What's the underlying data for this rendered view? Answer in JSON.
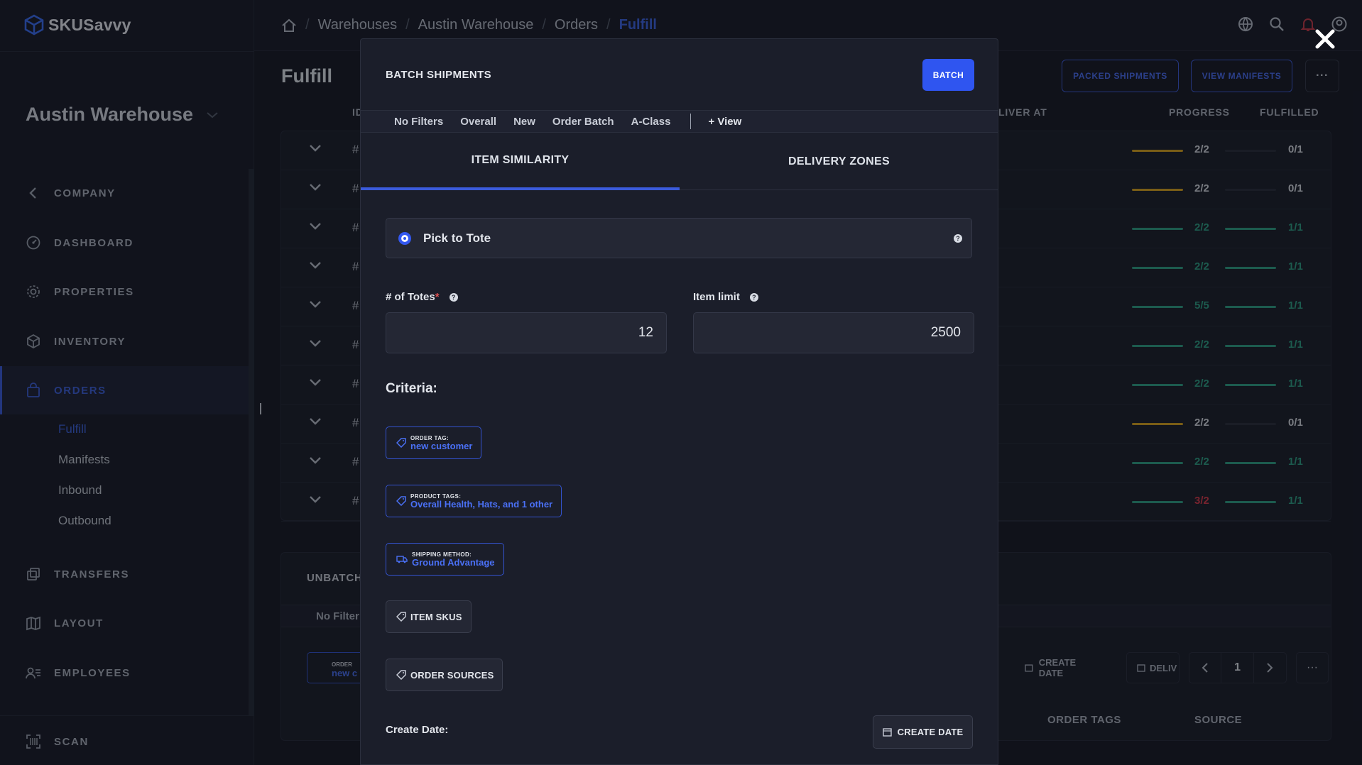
{
  "app": {
    "name": "SKUSavvy"
  },
  "sidebar": {
    "warehouse": "Austin Warehouse",
    "items": [
      {
        "label": "COMPANY",
        "icon": "chevron-left-icon"
      },
      {
        "label": "DASHBOARD",
        "icon": "dashboard-icon"
      },
      {
        "label": "PROPERTIES",
        "icon": "gear-icon"
      },
      {
        "label": "INVENTORY",
        "icon": "box-icon"
      },
      {
        "label": "ORDERS",
        "icon": "bag-icon",
        "active": true
      },
      {
        "label": "TRANSFERS",
        "icon": "transfer-icon"
      },
      {
        "label": "LAYOUT",
        "icon": "map-icon"
      },
      {
        "label": "EMPLOYEES",
        "icon": "employees-icon"
      },
      {
        "label": "SCAN",
        "icon": "scan-icon"
      }
    ],
    "subitems": [
      "Fulfill",
      "Manifests",
      "Inbound",
      "Outbound"
    ]
  },
  "breadcrumb": [
    "Warehouses",
    "Austin Warehouse",
    "Orders",
    "Fulfill"
  ],
  "page": {
    "title": "Fulfill",
    "buttons": {
      "packed": "PACKED SHIPMENTS",
      "manifests": "VIEW MANIFESTS",
      "more": "···"
    },
    "columns": {
      "id": "ID",
      "deliver_at": "LIVER AT",
      "progress": "PROGRESS",
      "fulfilled": "FULFILLED"
    },
    "rows": [
      {
        "hash": "#",
        "progress": "2/2",
        "fulfilled": "0/1",
        "state": "partial"
      },
      {
        "hash": "#",
        "progress": "2/2",
        "fulfilled": "0/1",
        "state": "partial"
      },
      {
        "hash": "#",
        "progress": "2/2",
        "fulfilled": "1/1",
        "state": "done"
      },
      {
        "hash": "#",
        "progress": "2/2",
        "fulfilled": "1/1",
        "state": "done"
      },
      {
        "hash": "#",
        "progress": "5/5",
        "fulfilled": "1/1",
        "state": "done"
      },
      {
        "hash": "#",
        "progress": "2/2",
        "fulfilled": "1/1",
        "state": "done"
      },
      {
        "hash": "#",
        "progress": "2/2",
        "fulfilled": "1/1",
        "state": "done"
      },
      {
        "hash": "#",
        "progress": "2/2",
        "fulfilled": "0/1",
        "state": "partial"
      },
      {
        "hash": "#",
        "progress": "2/2",
        "fulfilled": "1/1",
        "state": "done"
      },
      {
        "hash": "#",
        "progress": "3/2",
        "fulfilled": "1/1",
        "state": "over"
      }
    ],
    "unbatched": {
      "title": "UNBATCH",
      "filter": "No Filter",
      "chip_key": "ORDER",
      "chip_val": "new c",
      "create_date": "CREATE DATE",
      "deliv": "DELIV",
      "page_num": "1",
      "more": "···",
      "col_order_tags": "ORDER TAGS",
      "col_source": "SOURCE"
    }
  },
  "modal": {
    "title": "BATCH SHIPMENTS",
    "batch_button": "BATCH",
    "filters": [
      "No Filters",
      "Overall",
      "New",
      "Order Batch",
      "A-Class"
    ],
    "view_label": "+  View",
    "tabs": [
      "ITEM SIMILARITY",
      "DELIVERY ZONES"
    ],
    "active_tab": 0,
    "strategy": "Pick to Tote",
    "totes_label": "# of Totes",
    "totes_required": "*",
    "totes_value": "12",
    "item_limit_label": "Item limit",
    "item_limit_value": "2500",
    "criteria_label": "Criteria:",
    "chips": [
      {
        "key": "ORDER TAG:",
        "value": "new customer",
        "icon": "tag-icon"
      },
      {
        "key": "PRODUCT TAGS:",
        "value": "Overall Health,  Hats, and 1 other",
        "icon": "tag-icon"
      },
      {
        "key": "SHIPPING METHOD:",
        "value": "Ground Advantage",
        "icon": "truck-icon"
      }
    ],
    "plain_chips": [
      "ITEM SKUS",
      "ORDER SOURCES"
    ],
    "create_date_label": "Create Date:",
    "create_date_button": "CREATE DATE"
  },
  "colors": {
    "accent": "#3358f0",
    "done": "#2e9e83",
    "partial": "#d8a21e",
    "over": "#d33a4a",
    "empty": "#2a2e3b"
  }
}
